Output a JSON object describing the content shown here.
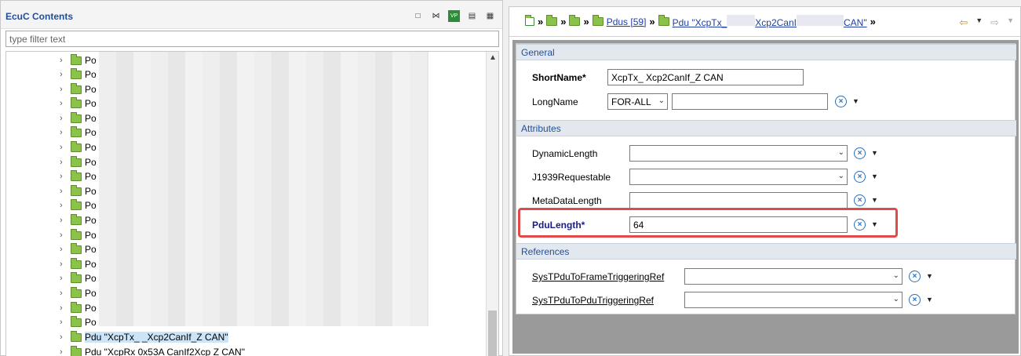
{
  "left": {
    "title": "EcuC Contents",
    "filter_placeholder": "type filter text",
    "tree_rows": [
      {
        "label": "Po"
      },
      {
        "label": "Po"
      },
      {
        "label": "Po"
      },
      {
        "label": "Po"
      },
      {
        "label": "Po"
      },
      {
        "label": "Po"
      },
      {
        "label": "Po"
      },
      {
        "label": "Po"
      },
      {
        "label": "Po"
      },
      {
        "label": "Po"
      },
      {
        "label": "Po"
      },
      {
        "label": "Po"
      },
      {
        "label": "Po"
      },
      {
        "label": "Po"
      },
      {
        "label": "Po"
      },
      {
        "label": "Po"
      },
      {
        "label": "Po"
      },
      {
        "label": "Po"
      },
      {
        "label": "Po"
      }
    ],
    "selected_row": "Pdu \"XcpTx_      _Xcp2CanIf_Z       CAN\"",
    "last_row": "Pdu \"XcpRx 0x53A CanIf2Xcp Z                     CAN\""
  },
  "right": {
    "breadcrumb": {
      "pdus_label": "Pdus [59]",
      "pdu_prefix": "Pdu \"XcpTx_",
      "pdu_mid": "Xcp2CanI",
      "pdu_suffix": "CAN\""
    },
    "sections": {
      "general": "General",
      "attributes": "Attributes",
      "references": "References"
    },
    "fields": {
      "shortname_label": "ShortName*",
      "shortname_value": "XcpTx_        Xcp2CanIf_Z      CAN",
      "longname_label": "LongName",
      "longname_lang": "FOR-ALL",
      "longname_value": "",
      "dynamic_length_label": "DynamicLength",
      "j1939_label": "J1939Requestable",
      "metadata_length_label": "MetaDataLength",
      "pdu_length_label": "PduLength*",
      "pdu_length_value": "64",
      "frame_trig_ref_label": "SysTPduToFrameTriggeringRef",
      "pdu_trig_ref_label": "SysTPduToPduTriggeringRef"
    }
  }
}
